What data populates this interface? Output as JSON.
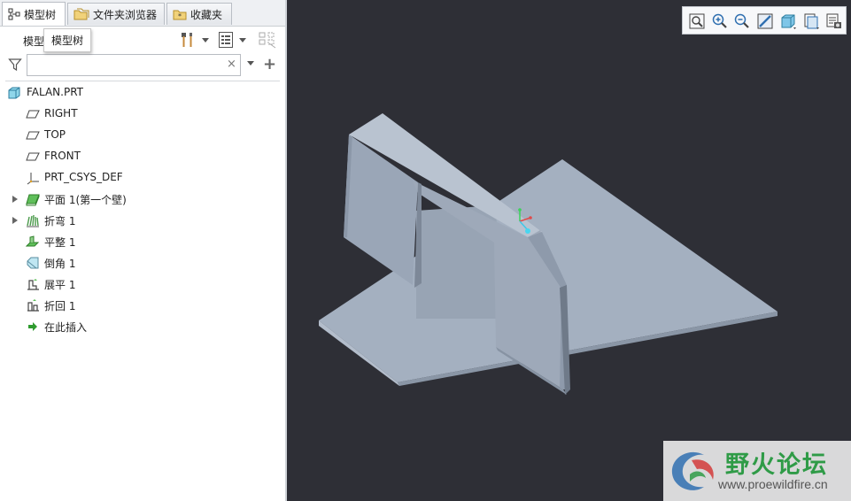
{
  "tabs": [
    {
      "label": "模型树",
      "icon": "tree-icon"
    },
    {
      "label": "文件夹浏览器",
      "icon": "folder-icon"
    },
    {
      "label": "收藏夹",
      "icon": "favorites-icon"
    }
  ],
  "model_toolbar": {
    "label": "模型",
    "tooltip": "模型树"
  },
  "filter": {
    "value": "",
    "placeholder": "",
    "clear_symbol": "×",
    "add_symbol": "+"
  },
  "tree": {
    "items": [
      {
        "label": "FALAN.PRT",
        "icon": "part-icon",
        "expandable": false
      },
      {
        "label": "RIGHT",
        "icon": "datum-plane-icon",
        "expandable": false
      },
      {
        "label": "TOP",
        "icon": "datum-plane-icon",
        "expandable": false
      },
      {
        "label": "FRONT",
        "icon": "datum-plane-icon",
        "expandable": false
      },
      {
        "label": "PRT_CSYS_DEF",
        "icon": "csys-icon",
        "expandable": false
      },
      {
        "label": "平面 1(第一个壁)",
        "icon": "planar-wall-icon",
        "expandable": true
      },
      {
        "label": "折弯 1",
        "icon": "bend-icon",
        "expandable": true
      },
      {
        "label": "平整 1",
        "icon": "flatten-icon",
        "expandable": false
      },
      {
        "label": "倒角 1",
        "icon": "chamfer-icon",
        "expandable": false
      },
      {
        "label": "展平 1",
        "icon": "unbend-icon",
        "expandable": false
      },
      {
        "label": "折回 1",
        "icon": "bend-back-icon",
        "expandable": false
      },
      {
        "label": "在此插入",
        "icon": "insert-here-icon",
        "expandable": false
      }
    ]
  },
  "view_toolbar": [
    "refit-icon",
    "zoom-in-icon",
    "zoom-out-icon",
    "repaint-icon",
    "display-style-icon",
    "saved-views-icon",
    "view-manager-icon"
  ],
  "watermark": {
    "title": "野火论坛",
    "url": "www.proewildfire.cn"
  },
  "colors": {
    "viewport_bg": "#2e2f36",
    "model_face": "#a4b0c0",
    "model_edge": "#7a8594",
    "accent_green": "#2f9b47"
  }
}
